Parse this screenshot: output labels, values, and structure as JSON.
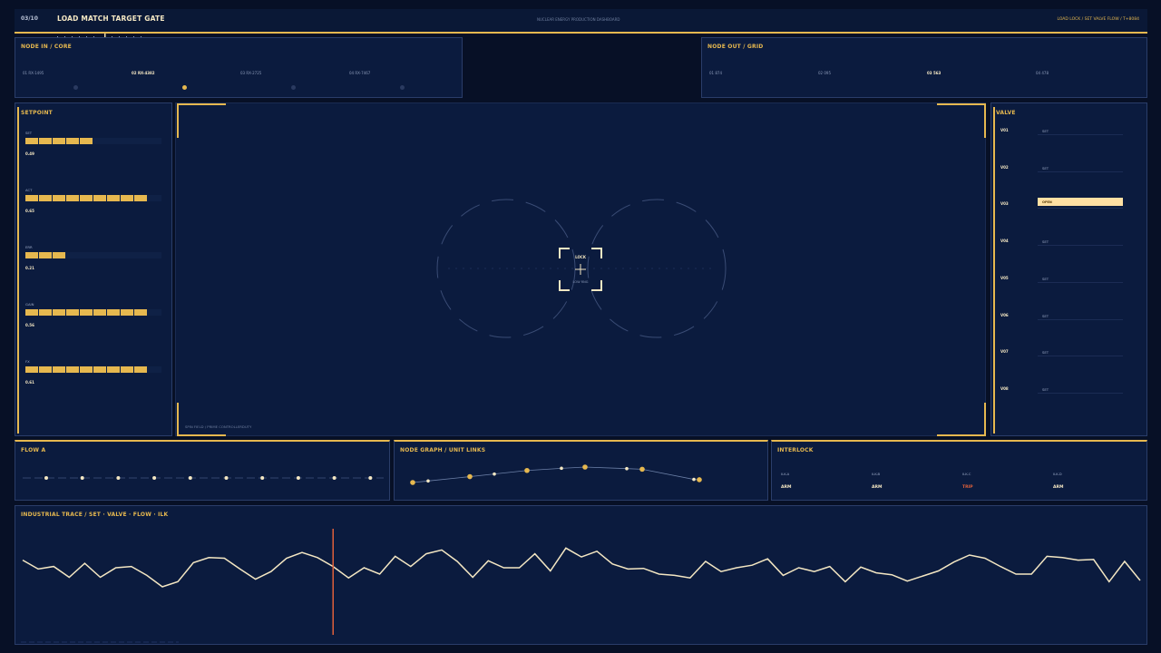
{
  "header": {
    "page_counter": "03/10",
    "title": "LOAD MATCH TARGET GATE",
    "center_label": "NUCLEAR ENERGY PRODUCTION DASHBOARD",
    "right_status": "LOAD LOCK  /  SET VALVE FLOW  /  T+8084"
  },
  "node_in": {
    "title": "NODE IN  /  CORE",
    "items": [
      {
        "label": "01 RX-1495",
        "active": false
      },
      {
        "label": "02 RX-4382",
        "active": true
      },
      {
        "label": "03 RX-2725",
        "active": false
      },
      {
        "label": "04 RX-7467",
        "active": false
      }
    ]
  },
  "node_out": {
    "title": "NODE OUT  /  GRID",
    "items": [
      {
        "label": "01 874",
        "active": false
      },
      {
        "label": "02 095",
        "active": false
      },
      {
        "label": "03 563",
        "active": true
      },
      {
        "label": "04 478",
        "active": false
      }
    ]
  },
  "setpoint": {
    "title": "SETPOINT",
    "rows": [
      {
        "label": "SET",
        "value": "0.49",
        "segments": 5
      },
      {
        "label": "ACT",
        "value": "0.65",
        "segments": 9
      },
      {
        "label": "ERR",
        "value": "0.21",
        "segments": 3
      },
      {
        "label": "GAIN",
        "value": "0.56",
        "segments": 9
      },
      {
        "label": "FX",
        "value": "0.61",
        "segments": 9
      }
    ]
  },
  "center": {
    "lock_label": "LOCK",
    "lock_sub": "LOW RNG",
    "footer_note": "SPIN FIELD  /  PRIME CONTROLLERDUTY"
  },
  "valve": {
    "title": "VALVE",
    "rows": [
      {
        "label": "V01",
        "state": "SET",
        "open": false
      },
      {
        "label": "V02",
        "state": "SET",
        "open": false
      },
      {
        "label": "V03",
        "state": "OPEN",
        "open": true
      },
      {
        "label": "V04",
        "state": "SET",
        "open": false
      },
      {
        "label": "V05",
        "state": "SET",
        "open": false
      },
      {
        "label": "V06",
        "state": "SET",
        "open": false
      },
      {
        "label": "V07",
        "state": "SET",
        "open": false
      },
      {
        "label": "V08",
        "state": "SET",
        "open": false
      }
    ]
  },
  "flow_a": {
    "title": "FLOW A",
    "dot_count": 10
  },
  "node_graph": {
    "title": "NODE GRAPH  /  UNIT LINKS",
    "points": [
      [
        0,
        0.0
      ],
      [
        1,
        0.1
      ],
      [
        2,
        0.38
      ],
      [
        3,
        0.55
      ],
      [
        4,
        0.78
      ],
      [
        5,
        0.92
      ],
      [
        6,
        1.0
      ],
      [
        7,
        0.9
      ],
      [
        8,
        0.86
      ],
      [
        9,
        0.2
      ],
      [
        10,
        0.18
      ]
    ]
  },
  "interlock": {
    "title": "INTERLOCK",
    "items": [
      {
        "label": "ILK-A",
        "status": "ARM"
      },
      {
        "label": "ILK-B",
        "status": "ARM"
      },
      {
        "label": "ILK-C",
        "status": "TRIP"
      },
      {
        "label": "ILK-D",
        "status": "ARM"
      }
    ]
  },
  "trace": {
    "title": "INDUSTRIAL TRACE  /  SET · VALVE · FLOW · ILK",
    "cursor_index": 20,
    "values": [
      0.72,
      0.58,
      0.62,
      0.45,
      0.67,
      0.45,
      0.6,
      0.62,
      0.48,
      0.3,
      0.38,
      0.68,
      0.76,
      0.75,
      0.58,
      0.42,
      0.54,
      0.75,
      0.84,
      0.76,
      0.62,
      0.44,
      0.6,
      0.5,
      0.78,
      0.62,
      0.82,
      0.88,
      0.7,
      0.45,
      0.71,
      0.6,
      0.6,
      0.82,
      0.55,
      0.91,
      0.77,
      0.86,
      0.66,
      0.58,
      0.59,
      0.5,
      0.48,
      0.44,
      0.7,
      0.54,
      0.6,
      0.64,
      0.74,
      0.48,
      0.6,
      0.54,
      0.62,
      0.38,
      0.61,
      0.52,
      0.49,
      0.39,
      0.47,
      0.55,
      0.69,
      0.8,
      0.75,
      0.62,
      0.5,
      0.5,
      0.78,
      0.76,
      0.72,
      0.73,
      0.38,
      0.7,
      0.4
    ]
  }
}
